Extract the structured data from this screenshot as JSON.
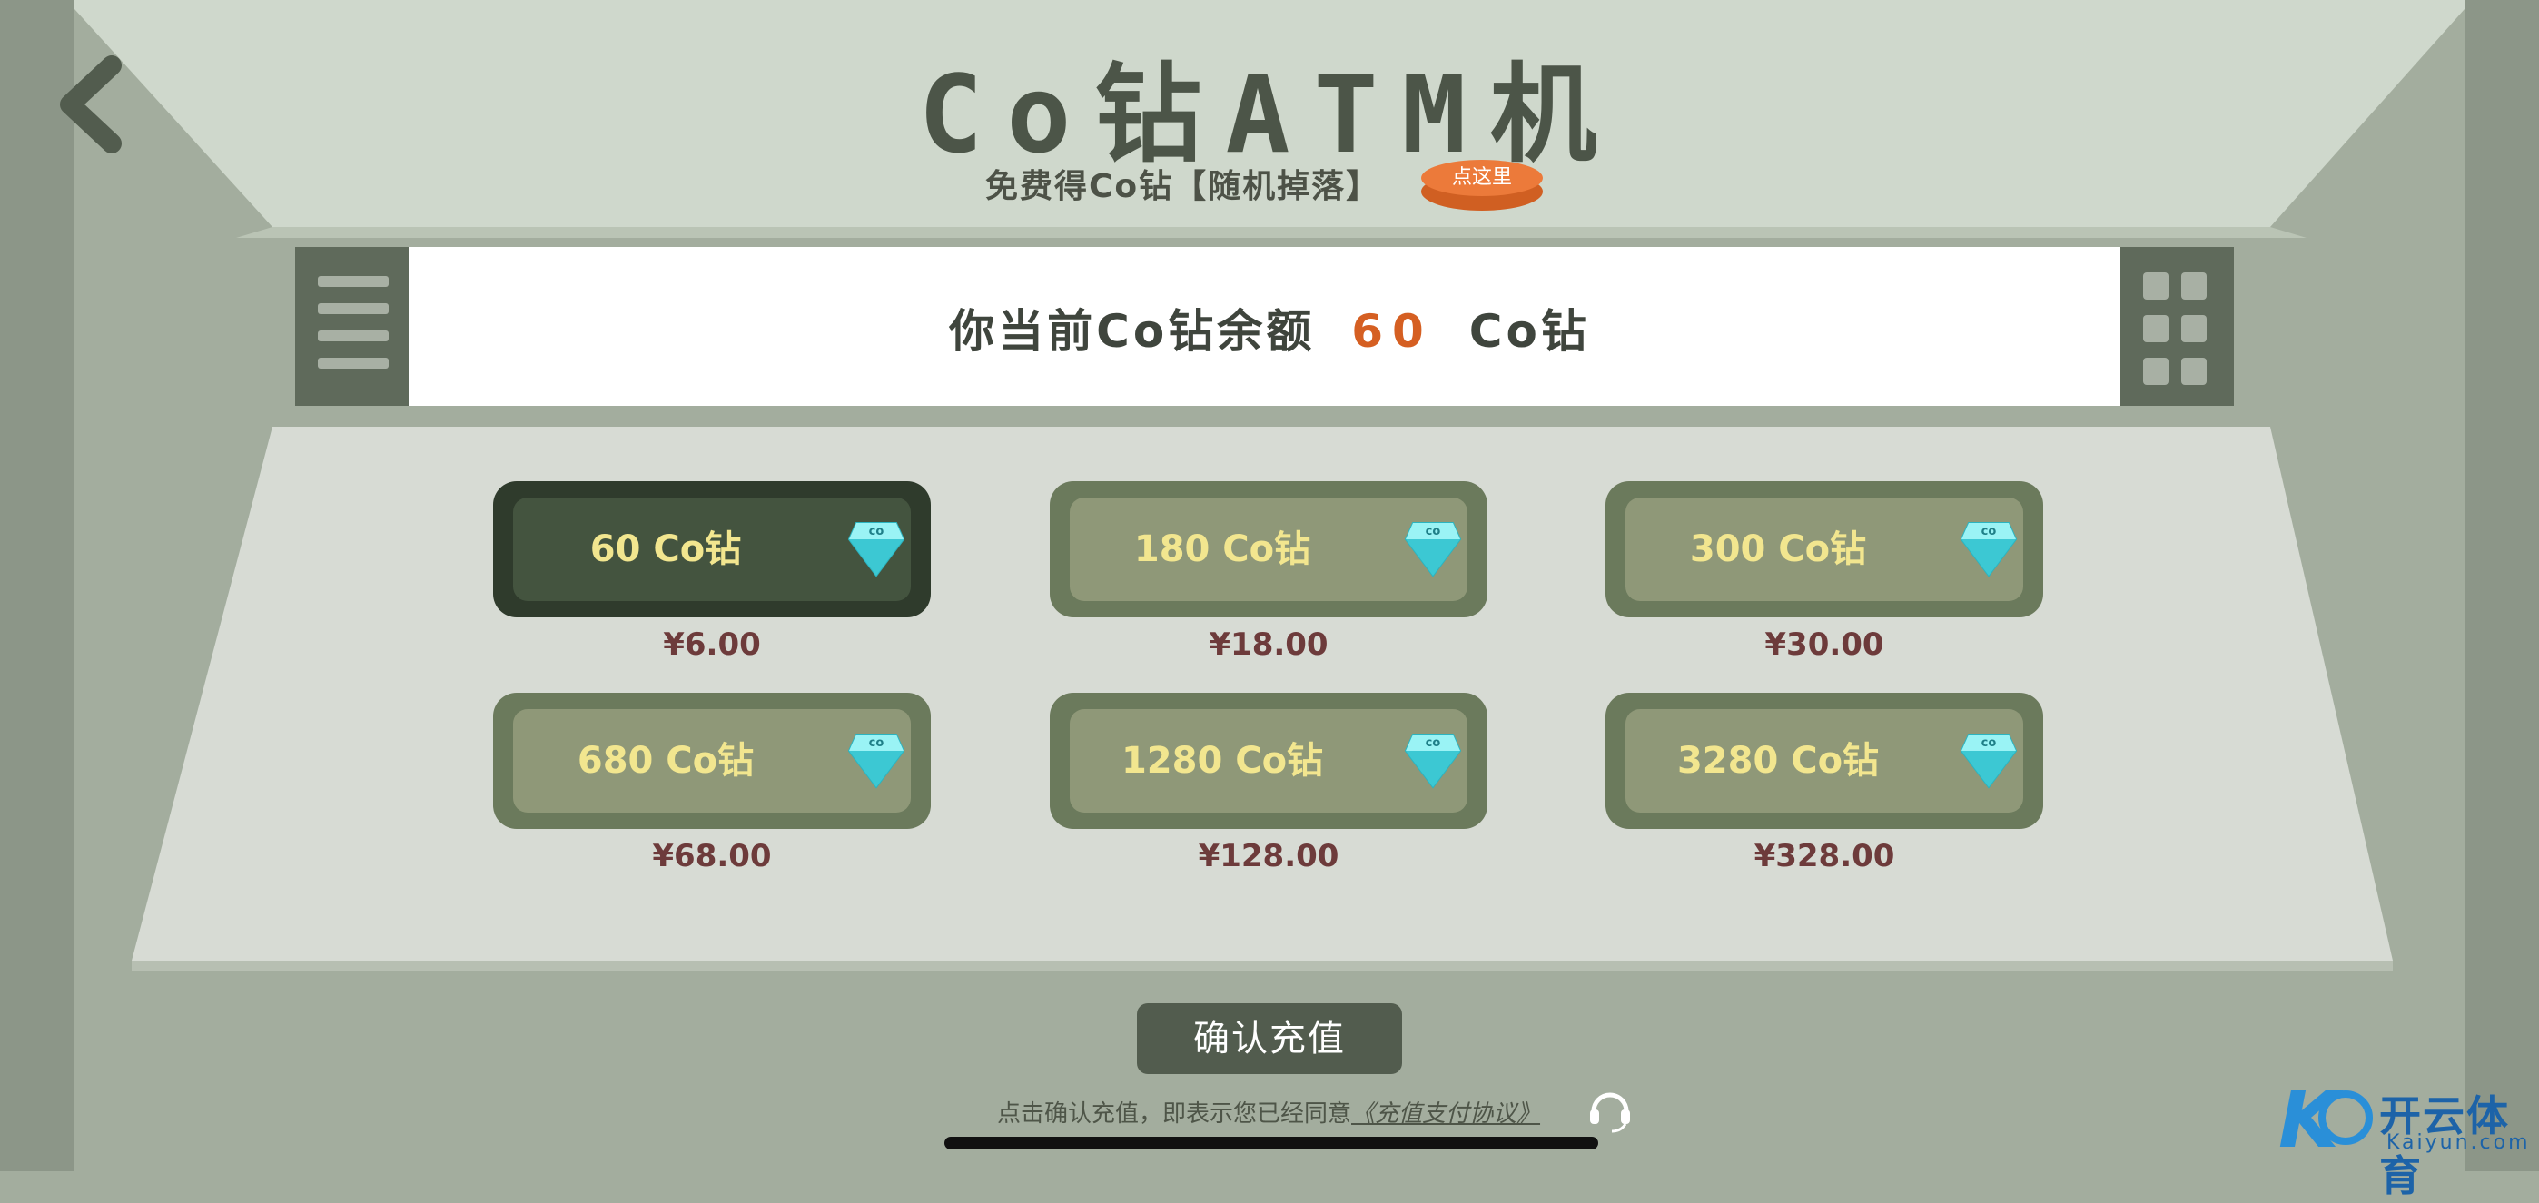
{
  "header": {
    "title": "Co钻ATM机",
    "subtitle": "免费得Co钻【随机掉落】",
    "promo_button": "点这里",
    "back_icon": "chevron-left-icon"
  },
  "balance": {
    "prefix": "你当前Co钻余额",
    "amount": "60",
    "unit": "Co钻"
  },
  "side_icons": {
    "left": "menu-lines-icon",
    "right": "grid-icon"
  },
  "packages": [
    {
      "label": "60 Co钻",
      "price": "¥6.00",
      "selected": true
    },
    {
      "label": "180 Co钻",
      "price": "¥18.00",
      "selected": false
    },
    {
      "label": "300 Co钻",
      "price": "¥30.00",
      "selected": false
    },
    {
      "label": "680 Co钻",
      "price": "¥68.00",
      "selected": false
    },
    {
      "label": "1280 Co钻",
      "price": "¥128.00",
      "selected": false
    },
    {
      "label": "3280 Co钻",
      "price": "¥328.00",
      "selected": false
    }
  ],
  "gem_badge": "co",
  "confirm_button": "确认充值",
  "agreement": {
    "text": "点击确认充值，即表示您已经同意",
    "link": "《充值支付协议》"
  },
  "support_icon": "headset-icon",
  "watermark": {
    "name_cn": "开云体育",
    "name_en": "Kaiyun.com"
  },
  "colors": {
    "accent_orange": "#d55f22",
    "selected_package": "#44543f",
    "package": "#8f9878",
    "price_text": "#6d3b3b",
    "package_label": "#f2e68f"
  }
}
